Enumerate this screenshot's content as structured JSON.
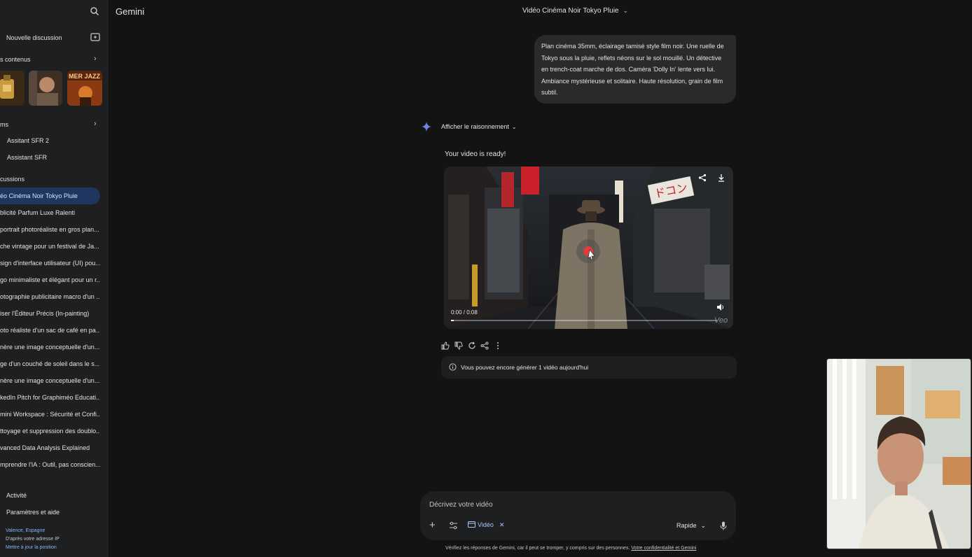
{
  "app": {
    "name": "Gemini"
  },
  "sidebar": {
    "new_chat": "Nouvelle discussion",
    "content_section": "s contenus",
    "gems_section": "ms",
    "gems": [
      "Assitant SFR 2",
      "Assistant SFR"
    ],
    "discussions_section": "cussions",
    "discussions": [
      "éo Cinéma Noir Tokyo Pluie",
      "blicité Parfum Luxe Ralenti",
      "portrait photoréaliste en gros plan...",
      "che vintage pour un festival de Ja...",
      "sign d'interface utilisateur (UI) pou...",
      "go minimaliste et élégant pour un r...",
      "otographie publicitaire macro d'un ...",
      "iser l'Éditeur Précis (In-painting)",
      "oto réaliste d'un sac de café en pa...",
      "nère une image conceptuelle d'un...",
      "ge d'un couché de soleil dans le s...",
      "nère une image conceptuelle d'un...",
      "kedIn Pitch for Graphiméo Educati...",
      "mini Workspace : Sécurité et Confi...",
      "ttoyage et suppression des doublo...",
      "vanced Data Analysis Explained",
      "mprendre l'IA : Outil, pas conscien..."
    ],
    "active_index": 0,
    "activity": "Activité",
    "settings": "Paramètres et aide",
    "location": {
      "place": "Valence, Espagne",
      "source": "D'après votre adresse IP",
      "update_link": "Mettre à jour la position"
    },
    "thumbnail_text": "MER JAZZ 2"
  },
  "header": {
    "conversation_title": "Vidéo Cinéma Noir Tokyo Pluie"
  },
  "chat": {
    "user_prompt": "Plan cinéma 35mm, éclairage tamisé style film noir. Une ruelle de Tokyo sous la pluie, reflets néons sur le sol mouillé. Un détective en trench-coat marche de dos. Caméra 'Dolly In' lente vers lui. Ambiance mystérieuse et solitaire. Haute résolution, grain de film subtil.",
    "show_reasoning": "Afficher le raisonnement",
    "response_text": "Your video is ready!",
    "video": {
      "time": "0:00 / 0:08",
      "progress": 0.01,
      "watermark": "Veo",
      "sign_text": "ドコン"
    },
    "notice": "Vous pouvez encore générer 1 vidéo aujourd'hui"
  },
  "composer": {
    "placeholder": "Décrivez votre vidéo",
    "tool_chip": "Vidéo",
    "mode": "Rapide"
  },
  "footer": {
    "disclaimer": "Vérifiez les réponses de Gemini, car il peut se tromper, y compris sur des personnes.",
    "privacy_link": "Votre confidentialité et Gemini"
  },
  "colors": {
    "background": "#131314",
    "sidebar": "#1e1f20",
    "active_item": "#1f3760",
    "link": "#8ab4f8",
    "bubble": "#282a2c"
  }
}
